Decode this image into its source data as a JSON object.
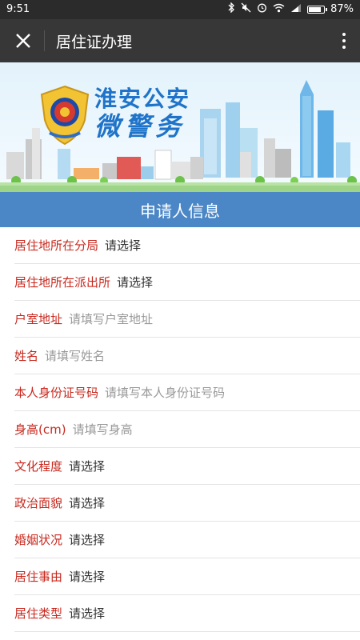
{
  "status": {
    "time": "9:51",
    "battery": "87%",
    "battery_level": 0.87
  },
  "titlebar": {
    "title": "居住证办理",
    "close_icon": "close-icon",
    "more_icon": "more-vertical-icon"
  },
  "banner": {
    "title_line1": "淮安公安",
    "title_line2": "微警务",
    "emblem_icon": "police-badge-icon"
  },
  "section": {
    "title": "申请人信息"
  },
  "form": {
    "rows": [
      {
        "label": "居住地所在分局",
        "value": "请选择",
        "type": "select"
      },
      {
        "label": "居住地所在派出所",
        "value": "请选择",
        "type": "select"
      },
      {
        "label": "户室地址",
        "value": "请填写户室地址",
        "type": "input"
      },
      {
        "label": "姓名",
        "value": "请填写姓名",
        "type": "input"
      },
      {
        "label": "本人身份证号码",
        "value": "请填写本人身份证号码",
        "type": "input"
      },
      {
        "label": "身高(cm)",
        "value": "请填写身高",
        "type": "input"
      },
      {
        "label": "文化程度",
        "value": "请选择",
        "type": "select"
      },
      {
        "label": "政治面貌",
        "value": "请选择",
        "type": "select"
      },
      {
        "label": "婚姻状况",
        "value": "请选择",
        "type": "select"
      },
      {
        "label": "居住事由",
        "value": "请选择",
        "type": "select"
      },
      {
        "label": "居住类型",
        "value": "请选择",
        "type": "select"
      }
    ]
  },
  "colors": {
    "label": "#c8281e",
    "section_header": "#4b87c6",
    "titlebar": "#373737",
    "banner_text": "#1f74c9"
  }
}
